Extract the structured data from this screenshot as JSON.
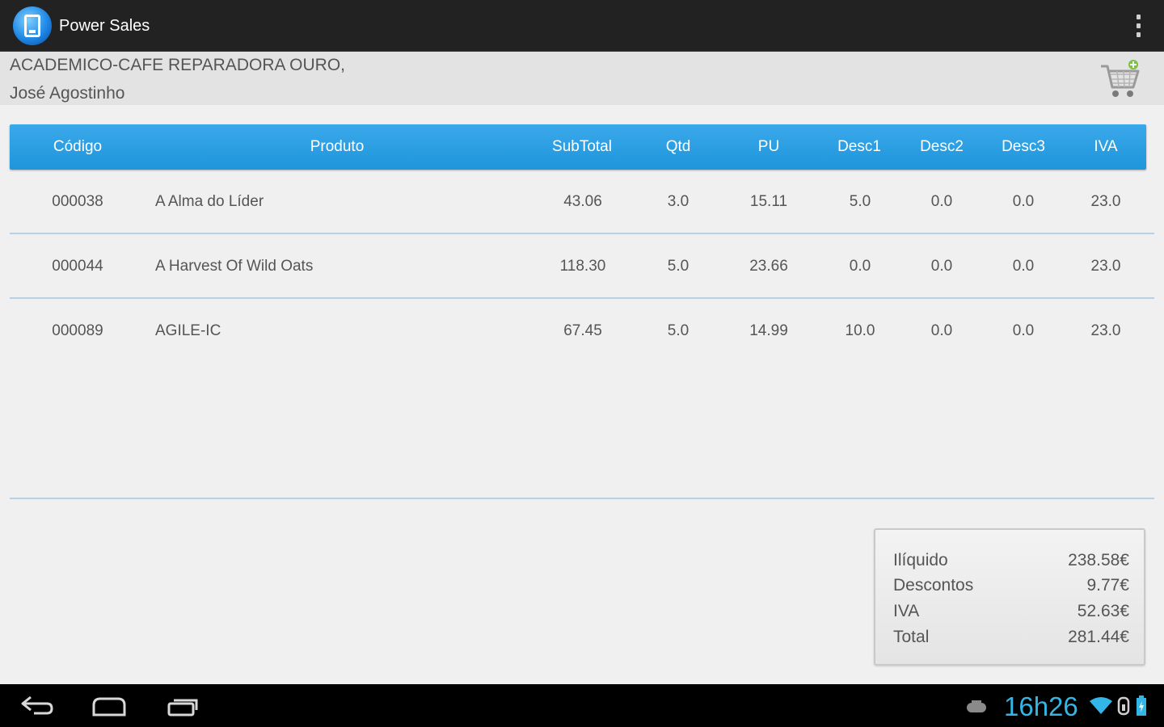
{
  "app": {
    "title": "Power Sales"
  },
  "customer": {
    "name": "ACADEMICO-CAFE REPARADORA OURO,",
    "contact": "José Agostinho"
  },
  "table": {
    "headers": {
      "codigo": "Código",
      "produto": "Produto",
      "subtotal": "SubTotal",
      "qtd": "Qtd",
      "pu": "PU",
      "desc1": "Desc1",
      "desc2": "Desc2",
      "desc3": "Desc3",
      "iva": "IVA"
    },
    "rows": [
      {
        "codigo": "000038",
        "produto": "A Alma do Líder",
        "subtotal": "43.06",
        "qtd": "3.0",
        "pu": "15.11",
        "desc1": "5.0",
        "desc2": "0.0",
        "desc3": "0.0",
        "iva": "23.0"
      },
      {
        "codigo": "000044",
        "produto": "A Harvest Of Wild Oats",
        "subtotal": "118.30",
        "qtd": "5.0",
        "pu": "23.66",
        "desc1": "0.0",
        "desc2": "0.0",
        "desc3": "0.0",
        "iva": "23.0"
      },
      {
        "codigo": "000089",
        "produto": "AGILE-IC",
        "subtotal": "67.45",
        "qtd": "5.0",
        "pu": "14.99",
        "desc1": "10.0",
        "desc2": "0.0",
        "desc3": "0.0",
        "iva": "23.0"
      }
    ]
  },
  "totals": {
    "iliquido_label": "Ilíquido",
    "iliquido_value": "238.58€",
    "descontos_label": "Descontos",
    "descontos_value": "9.77€",
    "iva_label": "IVA",
    "iva_value": "52.63€",
    "total_label": "Total",
    "total_value": "281.44€"
  },
  "status_bar": {
    "clock": "16h26"
  },
  "colors": {
    "accent": "#33b5e5",
    "header_blue": "#1f95db"
  }
}
